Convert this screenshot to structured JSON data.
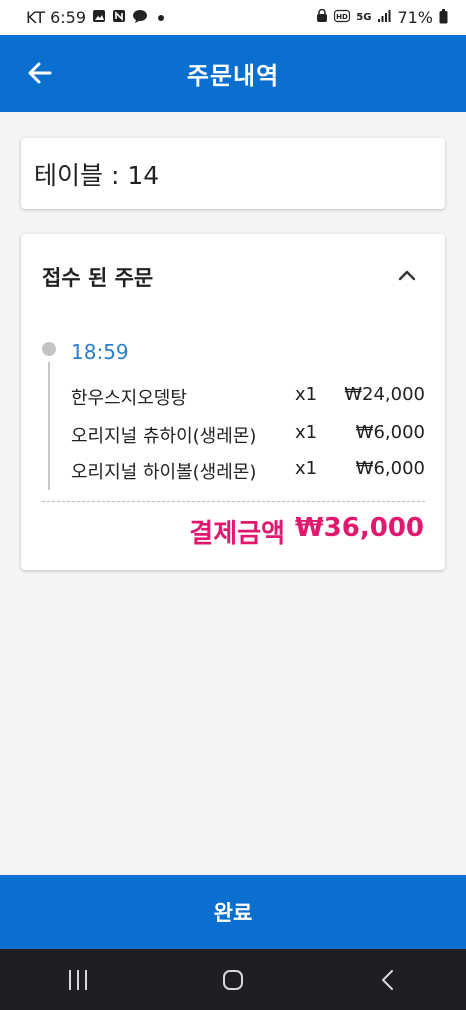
{
  "status_bar": {
    "carrier_time": "KT 6:59",
    "network": "5G",
    "battery": "71%"
  },
  "app_bar": {
    "title": "주문내역"
  },
  "table_card": {
    "text": "테이블 : 14"
  },
  "order_card": {
    "section_title": "접수 된 주문",
    "time": "18:59",
    "items": [
      {
        "name": "한우스지오뎅탕",
        "qty": "x1",
        "price": "₩24,000"
      },
      {
        "name": "오리지널 츄하이(생레몬)",
        "qty": "x1",
        "price": "₩6,000"
      },
      {
        "name": "오리지널 하이볼(생레몬)",
        "qty": "x1",
        "price": "₩6,000"
      }
    ],
    "total_label": "결제금액",
    "total_value": "₩36,000"
  },
  "bottom_button": {
    "label": "완료"
  },
  "colors": {
    "primary": "#0a6fce",
    "accent_total": "#e0186e",
    "time_blue": "#2b7fd0"
  }
}
